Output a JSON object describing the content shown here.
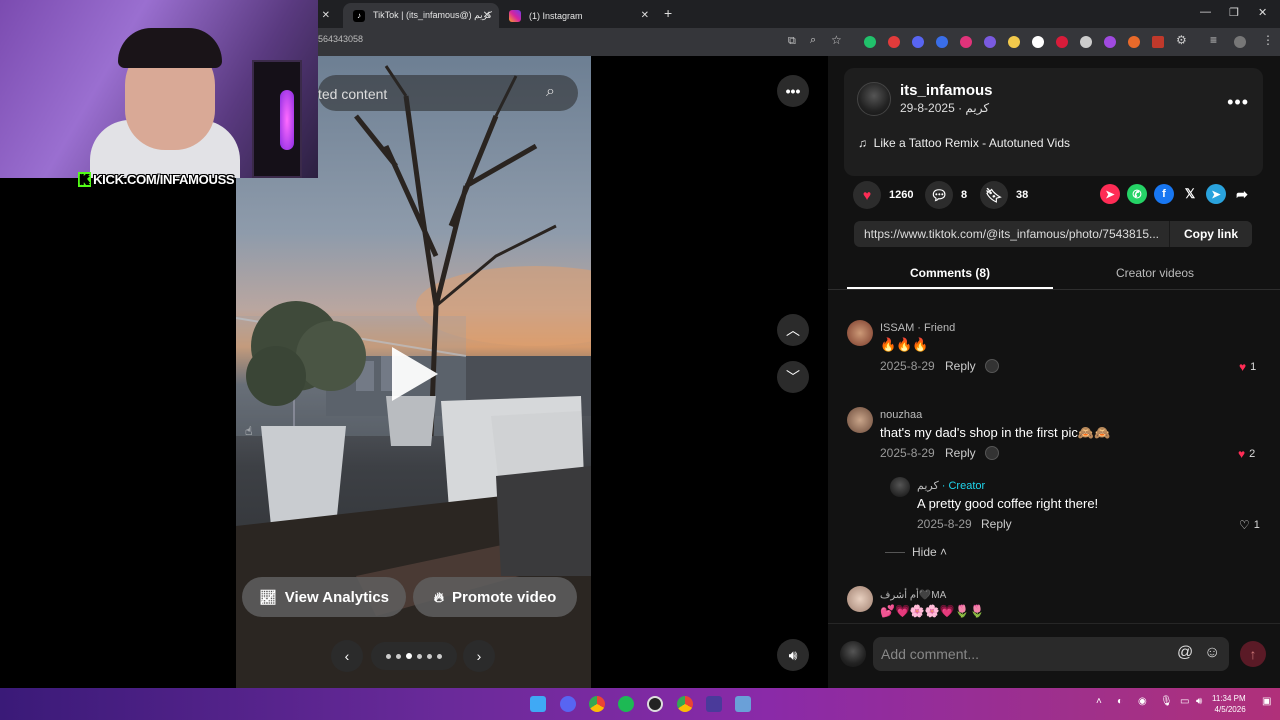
{
  "browser": {
    "tabs": [
      {
        "title": "TikTok | (its_infamous@) كريم",
        "active": true,
        "icon": "tiktok-icon"
      },
      {
        "title": "(1) Instagram",
        "active": false,
        "icon": "instagram-icon"
      }
    ],
    "url_fragment": "564343058"
  },
  "webcam": {
    "overlay_text_badge": "K",
    "overlay_text": "KICK.COM/INFAMOUSS"
  },
  "video": {
    "search_placeholder": "ted content",
    "analytics_label": "View Analytics",
    "promote_label": "Promote video",
    "carousel_dots": 6,
    "carousel_active": 2
  },
  "post": {
    "author": "its_infamous",
    "author_sub": "كريم · 2025-8-29",
    "music": "Like a Tattoo Remix - Autotuned Vids",
    "likes": "1260",
    "comments": "8",
    "saves": "38",
    "link": "https://www.tiktok.com/@its_infamous/photo/7543815...",
    "copy_label": "Copy link",
    "tabs": {
      "comments": "Comments (8)",
      "creator_videos": "Creator videos"
    }
  },
  "comments": [
    {
      "name": "ISSAM",
      "badge": " · Friend",
      "text": "🔥🔥🔥",
      "date": "2025-8-29",
      "reply": "Reply",
      "likes": "1",
      "liked": true
    },
    {
      "name": "nouzhaa",
      "badge": "",
      "text": "that's my dad's shop in the first pic🙈🙈",
      "date": "2025-8-29",
      "reply": "Reply",
      "likes": "2",
      "liked": true
    },
    {
      "name": "أم أشرف🖤MA",
      "badge": "",
      "text": "💕💗🌸🌸💗🌷🌷",
      "date": "",
      "reply": "",
      "likes": "",
      "liked": false
    }
  ],
  "creator_reply": {
    "name": "كريم",
    "badge": " · Creator",
    "text": "A pretty good coffee right there!",
    "date": "2025-8-29",
    "reply": "Reply",
    "likes": "1",
    "hide": "Hide"
  },
  "comment_input_placeholder": "Add comment...",
  "clock": {
    "time": "11:34 PM",
    "date": "4/5/2026"
  },
  "colors": {
    "tiktok_red": "#fe2c55",
    "creator_cyan": "#20d5ec",
    "kick_green": "#53fc18"
  }
}
